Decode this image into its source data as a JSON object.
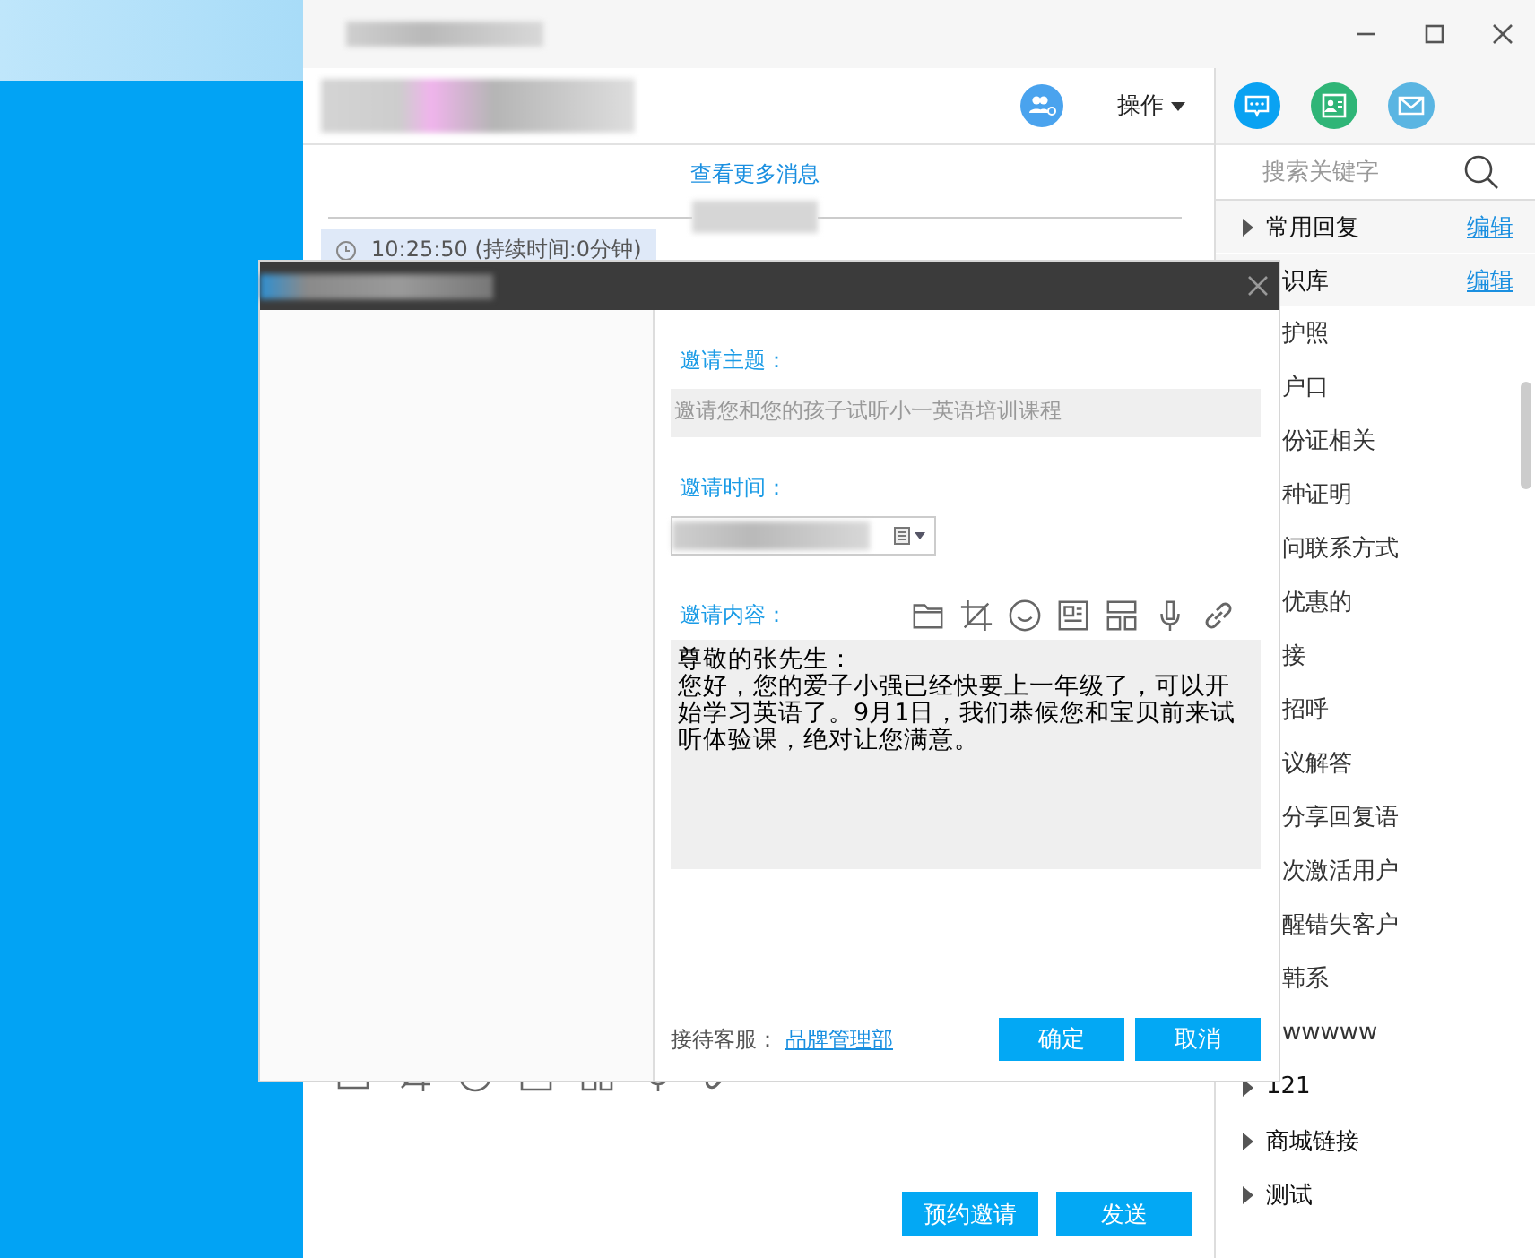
{
  "chat": {
    "more_messages_link": "查看更多消息",
    "operation_menu": "操作",
    "time_chip": "10:25:50 (持续时间:0分钟)",
    "buttons": [
      "预约邀请",
      "发送"
    ]
  },
  "modal": {
    "subject": {
      "label": "邀请主题：",
      "value": "邀请您和您的孩子试听小一英语培训课程"
    },
    "time": {
      "label": "邀请时间："
    },
    "content": {
      "label": "邀请内容：",
      "paragraphs": [
        "尊敬的张先生：",
        "您好，您的爱子小强已经快要上一年级了，可以开始学习英语了。9月1日，我们恭候您和宝贝前来试听体验课，绝对让您满意。"
      ]
    },
    "agent_label": "接待客服：",
    "agent_link": "品牌管理部",
    "buttons": [
      "确定",
      "取消"
    ]
  },
  "side": {
    "search": {
      "placeholder": "搜索关键字"
    },
    "groups": [
      {
        "label": "常用回复",
        "edit": "编辑",
        "expanded": false
      },
      {
        "label": "识库",
        "edit": "编辑",
        "expanded": true,
        "children": [
          {
            "label": "护照"
          },
          {
            "label": "户口"
          },
          {
            "label": "份证相关"
          },
          {
            "label": "种证明"
          },
          {
            "label": "问联系方式"
          },
          {
            "label": "优惠的"
          },
          {
            "label": "接"
          },
          {
            "label": "招呼"
          },
          {
            "label": "议解答"
          },
          {
            "label": "分享回复语"
          },
          {
            "label": "次激活用户"
          },
          {
            "label": "醒错失客户"
          },
          {
            "label": "韩系"
          },
          {
            "label": "wwwww"
          }
        ]
      },
      {
        "label": "121",
        "expanded": false
      },
      {
        "label": "商城链接",
        "expanded": false
      },
      {
        "label": "测试",
        "expanded": false
      }
    ]
  }
}
